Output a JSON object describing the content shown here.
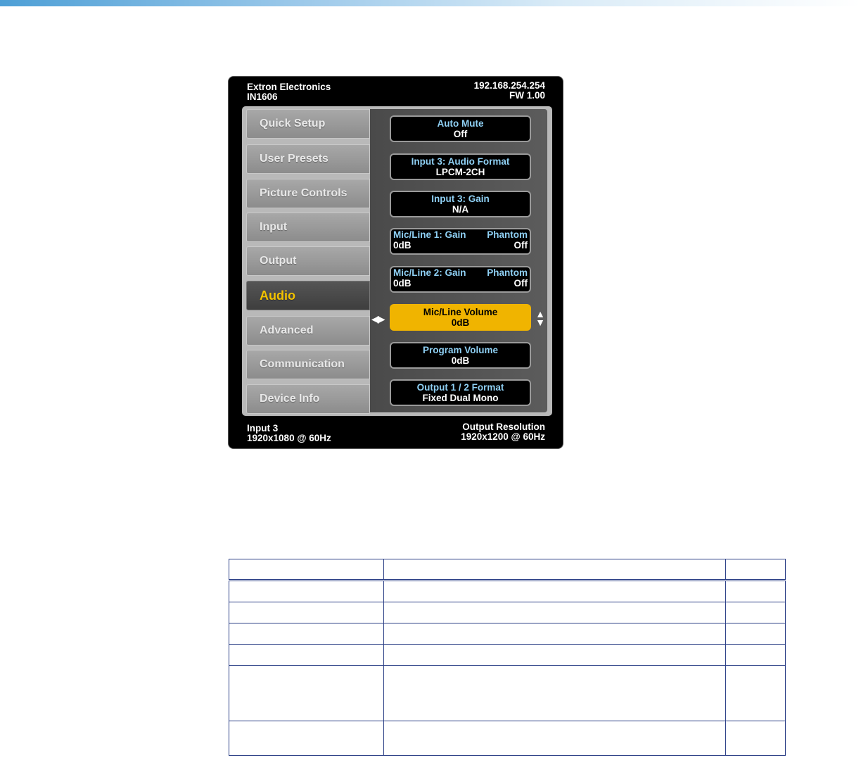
{
  "osd": {
    "header_left": [
      "Extron Electronics",
      "IN1606"
    ],
    "header_right": [
      "192.168.254.254",
      "FW 1.00"
    ],
    "footer_left": [
      "Input 3",
      "1920x1080 @ 60Hz"
    ],
    "footer_right": [
      "Output Resolution",
      "1920x1200 @ 60Hz"
    ],
    "tabs": [
      {
        "label": "Quick Setup"
      },
      {
        "label": "User Presets"
      },
      {
        "label": "Picture Controls"
      },
      {
        "label": "Input"
      },
      {
        "label": "Output"
      },
      {
        "label": "Audio",
        "active": true
      },
      {
        "label": "Advanced"
      },
      {
        "label": "Communication"
      },
      {
        "label": "Device Info"
      }
    ],
    "items": [
      {
        "title": "Auto Mute",
        "value": "Off"
      },
      {
        "title": "Input 3: Audio Format",
        "value": "LPCM-2CH"
      },
      {
        "title": "Input 3: Gain",
        "value": "N/A"
      },
      {
        "title": "Mic/Line 1: Gain",
        "title2": "Phantom",
        "value": "0dB",
        "value2": "Off"
      },
      {
        "title": "Mic/Line 2: Gain",
        "title2": "Phantom",
        "value": "0dB",
        "value2": "Off"
      },
      {
        "title": "Mic/Line Volume",
        "value": "0dB",
        "selected": true
      },
      {
        "title": "Program Volume",
        "value": "0dB"
      },
      {
        "title": "Output 1 / 2 Format",
        "value": "Fixed Dual Mono"
      }
    ]
  },
  "colors": {
    "selected": "#f0b400",
    "active_tab_text": "#f2c200",
    "item_title": "#8fd0f4",
    "table_border": "#2b3f86"
  },
  "table": {
    "columns": [
      "",
      "",
      ""
    ],
    "rows": [
      [
        "",
        "",
        ""
      ],
      [
        "",
        "",
        ""
      ],
      [
        "",
        "",
        ""
      ],
      [
        "",
        "",
        ""
      ],
      [
        "",
        "",
        ""
      ],
      [
        "",
        "",
        ""
      ]
    ]
  }
}
